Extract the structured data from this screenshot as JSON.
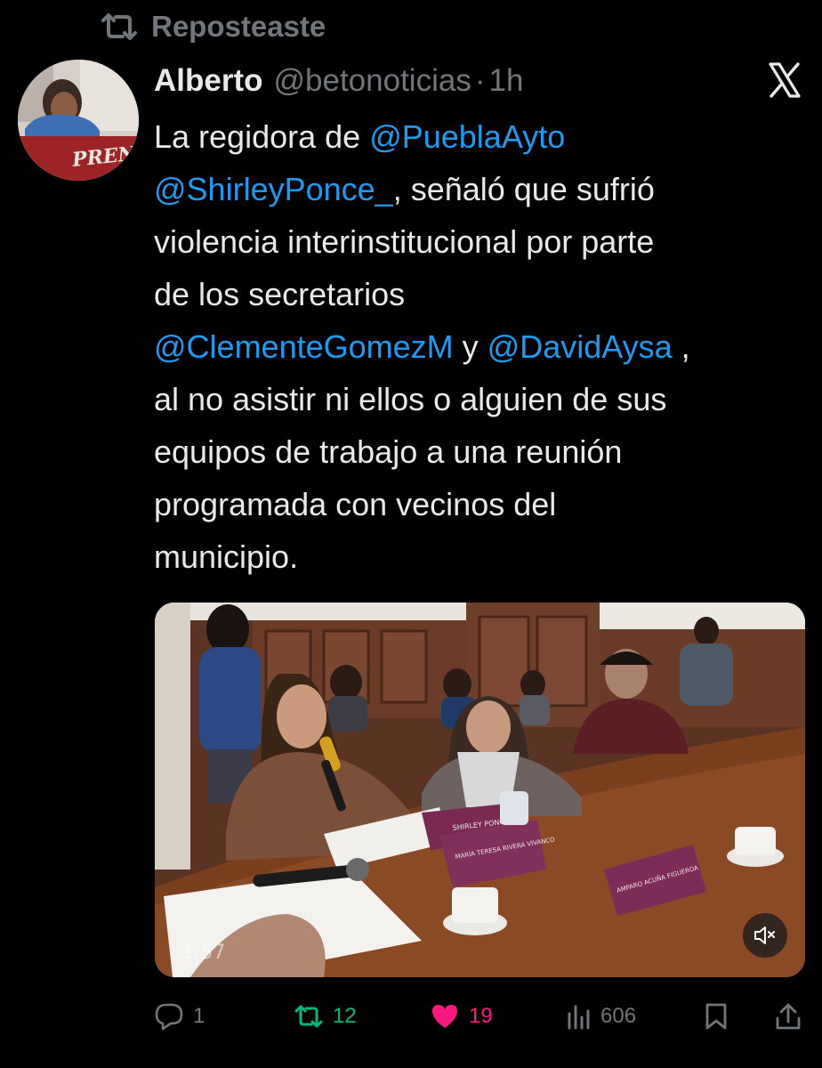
{
  "repost_banner": {
    "label": "Reposteaste",
    "icon": "repost-icon"
  },
  "tweet": {
    "author": {
      "name": "Alberto",
      "handle": "@betonoticias",
      "separator": "·",
      "time": "1h",
      "avatar_caption": "PRENS"
    },
    "platform_icon": "x-logo-icon",
    "text": {
      "line1_prefix": "La regidora de ",
      "mention1": "@PueblaAyto",
      "mention2": "@ShirleyPonce_",
      "line2_suffix": ", señaló que sufrió",
      "line3": "violencia interinstitucional por parte",
      "line4": "de los secretarios",
      "mention3": "@ClementeGomezM",
      "line5_middle": " y ",
      "mention4": "@DavidAysa",
      "line5_suffix": " ,",
      "line6": "al no asistir ni ellos o alguien de sus",
      "line7": "equipos de trabajo a una reunión",
      "line8": "programada con vecinos del",
      "line9": "municipio."
    },
    "media": {
      "video_time": "1:57",
      "mute_icon": "volume-muted-icon",
      "nameplates": [
        "SHIRLEY PONCE",
        "MARÍA TERESA RIVERA VIVANCO",
        "AMPARO ACUÑA FIGUEROA"
      ]
    },
    "actions": {
      "replies": "1",
      "reposts": "12",
      "likes": "19",
      "views": "606"
    }
  },
  "colors": {
    "background": "#000000",
    "text": "#e7e9ea",
    "muted": "#71767b",
    "link": "#1d9bf0",
    "repost_active": "#00ba7c",
    "like_active": "#f91880"
  }
}
